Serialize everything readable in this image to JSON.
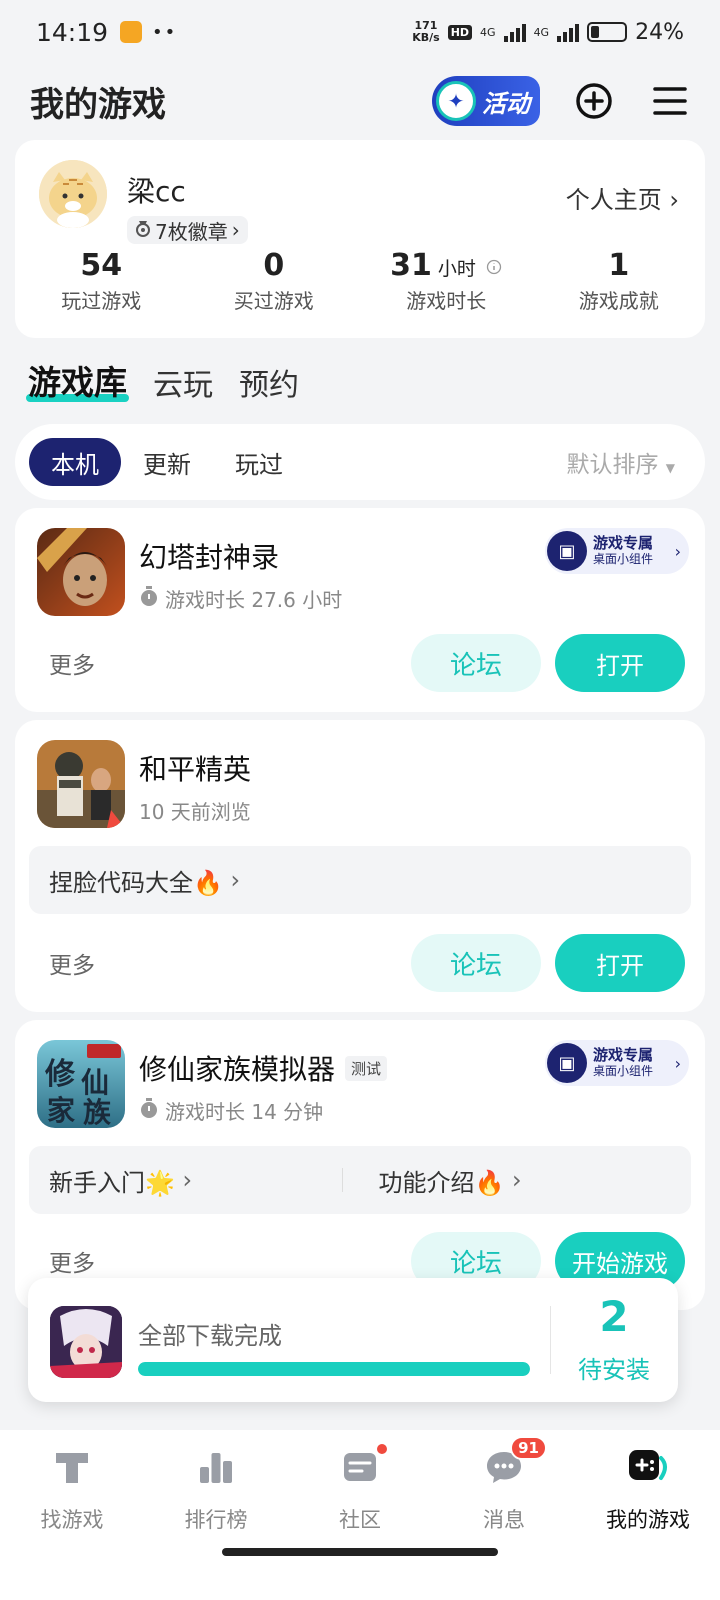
{
  "status": {
    "time": "14:19",
    "speed_top": "171",
    "speed_bottom": "KB/s",
    "hd": "HD",
    "net1": "4G",
    "net2": "4G",
    "battery": "24%",
    "battery_level": 0.24
  },
  "header": {
    "title": "我的游戏",
    "activity_label": "活动"
  },
  "profile": {
    "username": "梁cc",
    "badges": "7枚徽章",
    "homepage_link": "个人主页",
    "stats": [
      {
        "value": "54",
        "unit": "",
        "label": "玩过游戏"
      },
      {
        "value": "0",
        "unit": "",
        "label": "买过游戏"
      },
      {
        "value": "31",
        "unit": "小时",
        "label": "游戏时长"
      },
      {
        "value": "1",
        "unit": "",
        "label": "游戏成就"
      }
    ]
  },
  "tabs": [
    "游戏库",
    "云玩",
    "预约"
  ],
  "filters": {
    "chips": [
      "本机",
      "更新",
      "玩过"
    ],
    "sort": "默认排序"
  },
  "widget": {
    "line1": "游戏专属",
    "line2": "桌面小组件"
  },
  "games": [
    {
      "name": "幻塔封神录",
      "sub": "游戏时长 27.6 小时",
      "more": "更多",
      "forum": "论坛",
      "action": "打开"
    },
    {
      "name": "和平精英",
      "sub": "10 天前浏览",
      "link": "捏脸代码大全🔥",
      "more": "更多",
      "forum": "论坛",
      "action": "打开"
    },
    {
      "name": "修仙家族模拟器",
      "tag": "测试",
      "sub": "游戏时长 14 分钟",
      "link1": "新手入门🌟",
      "link2": "功能介绍🔥",
      "more": "更多",
      "forum": "论坛",
      "action": "开始游戏"
    }
  ],
  "download": {
    "status": "全部下载完成",
    "progress": 1.0,
    "count": "2",
    "count_label": "待安装"
  },
  "nav": [
    {
      "label": "找游戏",
      "icon": "find-game-icon"
    },
    {
      "label": "排行榜",
      "icon": "ranking-icon"
    },
    {
      "label": "社区",
      "icon": "community-icon"
    },
    {
      "label": "消息",
      "icon": "message-icon",
      "badge": "91"
    },
    {
      "label": "我的游戏",
      "icon": "my-games-icon",
      "active": true
    }
  ]
}
